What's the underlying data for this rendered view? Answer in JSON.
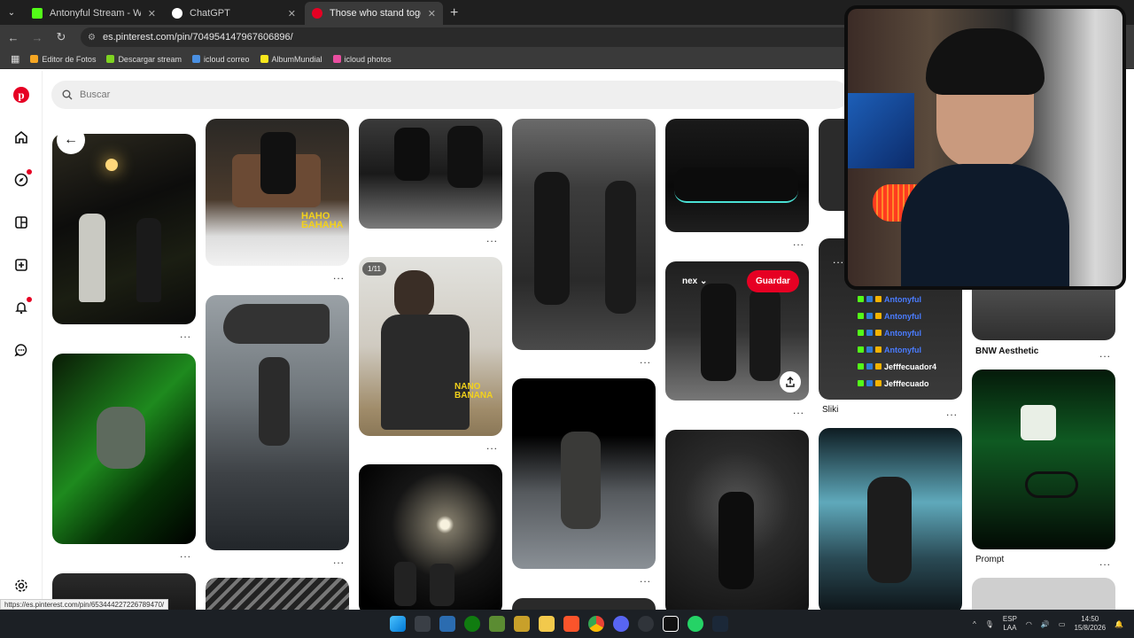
{
  "browser": {
    "tabs": [
      {
        "title": "Antonyful Stream - Watch Live",
        "favicon_color": "#53fc18"
      },
      {
        "title": "ChatGPT",
        "favicon_color": "#ffffff"
      },
      {
        "title": "Those who stand together.",
        "favicon_color": "#e60023"
      }
    ],
    "active_tab_index": 2,
    "url": "es.pinterest.com/pin/704954147967606896/",
    "bookmarks": [
      {
        "label": "Editor de Fotos",
        "color": "#f5a623"
      },
      {
        "label": "Descargar stream",
        "color": "#7ed321"
      },
      {
        "label": "icloud correo",
        "color": "#4a90e2"
      },
      {
        "label": "AlbumMundial",
        "color": "#f8e71c"
      },
      {
        "label": "icloud photos",
        "color": "#e94ea0"
      }
    ]
  },
  "pinterest": {
    "search_placeholder": "Buscar",
    "brand_color": "#e60023",
    "rail_icons": [
      "pinterest-logo-icon",
      "home-icon",
      "explore-icon",
      "boards-icon",
      "create-icon",
      "notifications-icon",
      "messages-icon",
      "settings-icon"
    ],
    "overlay": {
      "nex_label": "nex ⌄",
      "save_label": "Guardar",
      "page_badge": "1/11"
    },
    "captions": {
      "sliki": "Sliki",
      "bnw": "BNW Aesthetic",
      "prompt": "Prompt"
    },
    "more_label": "..."
  },
  "stream_chat": {
    "lines": [
      {
        "name": "Antonyful",
        "color": "#4a7cff"
      },
      {
        "name": "Antonyful",
        "color": "#4a7cff"
      },
      {
        "name": "Antonyful",
        "color": "#4a7cff"
      },
      {
        "name": "Antonyful",
        "color": "#4a7cff"
      },
      {
        "name": "Jefffecuador4",
        "color": "#ffffff"
      },
      {
        "name": "Jefffecuado",
        "color": "#ffffff"
      }
    ]
  },
  "status_bar_url": "https://es.pinterest.com/pin/653444227226789470/",
  "taskbar": {
    "lang_line1": "ESP",
    "lang_line2": "LAA",
    "time": "14:50",
    "date": "15/8/2026"
  }
}
